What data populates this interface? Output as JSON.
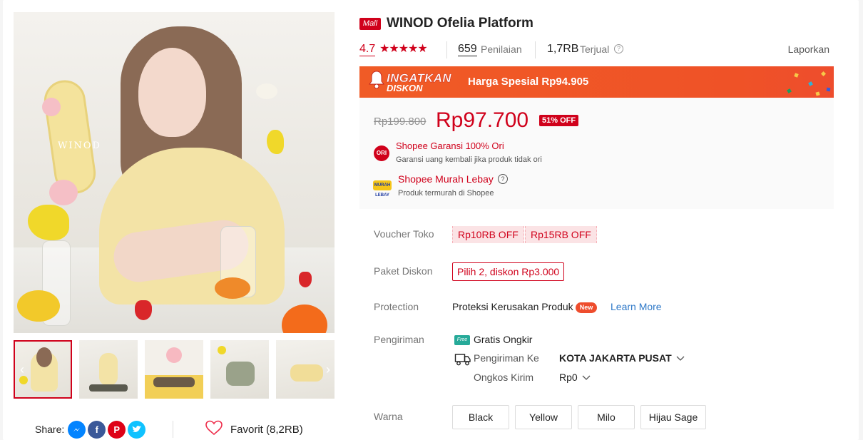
{
  "product": {
    "mall_badge": "Mall",
    "title": "WINOD Ofelia Platform",
    "brand_mark": "WINOD",
    "rating": "4.7",
    "stars": "★★★★★",
    "reviews_count": "659",
    "reviews_label": "Penilaian",
    "sold_count": "1,7RB",
    "sold_label": "Terjual",
    "report_label": "Laporkan"
  },
  "flash": {
    "logo_line1": "INGATKAN",
    "logo_line2": "DISKON",
    "text": "Harga Spesial Rp94.905"
  },
  "price": {
    "original": "Rp199.800",
    "current": "Rp97.700",
    "discount_badge": "51% OFF"
  },
  "guarantee": {
    "icon_text": "ORI",
    "title": "Shopee Garansi 100% Ori",
    "subtitle": "Garansi uang kembali jika produk tidak ori"
  },
  "cheap": {
    "icon_text": "MURAH LEBAY",
    "title": "Shopee Murah Lebay",
    "subtitle": "Produk termurah di Shopee"
  },
  "voucher": {
    "label": "Voucher Toko",
    "items": [
      "Rp10RB OFF",
      "Rp15RB OFF"
    ]
  },
  "bundle": {
    "label": "Paket Diskon",
    "text": "Pilih 2, diskon Rp3.000"
  },
  "protection": {
    "label": "Protection",
    "text": "Proteksi Kerusakan Produk",
    "badge": "New",
    "link": "Learn More"
  },
  "shipping": {
    "label": "Pengiriman",
    "free_icon": "Free",
    "free_text": "Gratis Ongkir",
    "to_label": "Pengiriman Ke",
    "to_value": "KOTA JAKARTA PUSAT",
    "cost_label": "Ongkos Kirim",
    "cost_value": "Rp0"
  },
  "variants": {
    "label": "Warna",
    "options": [
      "Black",
      "Yellow",
      "Milo",
      "Hijau Sage"
    ]
  },
  "share": {
    "label": "Share:",
    "icons": [
      "messenger-icon",
      "facebook-icon",
      "pinterest-icon",
      "twitter-icon"
    ]
  },
  "favorite": {
    "label": "Favorit (8,2RB)"
  },
  "colors": {
    "accent": "#d0011b",
    "flash": "#ef5227",
    "link": "#2f79c8"
  }
}
